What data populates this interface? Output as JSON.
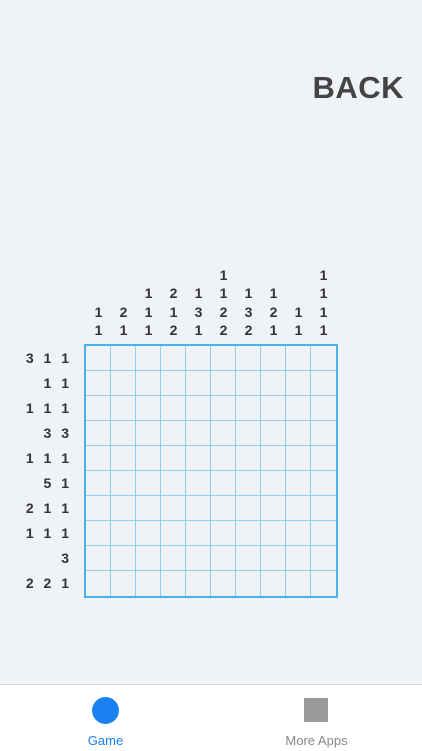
{
  "header": {
    "back_label": "BACK"
  },
  "puzzle": {
    "column_clues": [
      [
        "1",
        "1"
      ],
      [
        "2",
        "1"
      ],
      [
        "1",
        "1",
        "1"
      ],
      [
        "2",
        "1",
        "2"
      ],
      [
        "1",
        "3",
        "1"
      ],
      [
        "1",
        "1",
        "2",
        "2"
      ],
      [
        "1",
        "3",
        "2"
      ],
      [
        "1",
        "2",
        "1"
      ],
      [
        "1",
        "1"
      ],
      [
        "1",
        "1",
        "1",
        "1"
      ]
    ],
    "row_clues": [
      "3 1 1",
      "1 1",
      "1 1 1",
      "3 3",
      "1 1 1",
      "5 1",
      "2 1 1",
      "1 1 1",
      "3",
      "2 2 1"
    ],
    "grid_size": 10
  },
  "tab_bar": {
    "tabs": [
      {
        "label": "Game",
        "icon": "circle-icon",
        "active": true
      },
      {
        "label": "More Apps",
        "icon": "square-icon",
        "active": false
      }
    ]
  },
  "colors": {
    "background": "#eff2f7",
    "grid_border": "#48b4ea",
    "grid_line": "#8fd0f2",
    "active_tab": "#1a82f0",
    "inactive_tab": "#888888",
    "inactive_icon": "#999999"
  }
}
